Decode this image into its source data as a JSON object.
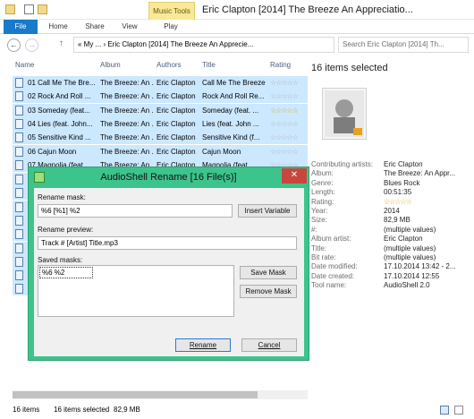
{
  "window": {
    "title": "Eric Clapton [2014] The Breeze An Appreciatio...",
    "context_tab": "Music Tools"
  },
  "ribbon": {
    "tabs": [
      "File",
      "Home",
      "Share",
      "View",
      "Play"
    ]
  },
  "nav": {
    "back_glyph": "←",
    "forward_glyph": "→",
    "up_glyph": "↑",
    "address": "«  My ...  ›  Eric Clapton [2014] The Breeze An Apprecie...",
    "search_placeholder": "Search Eric Clapton [2014] Th..."
  },
  "columns": [
    "Name",
    "Album",
    "Authors",
    "Title",
    "Rating"
  ],
  "files": [
    {
      "name": "01 Call Me The Bre...",
      "album": "The Breeze: An ...",
      "author": "Eric Clapton",
      "title": "Call Me The Breeze",
      "rating": 0
    },
    {
      "name": "02 Rock And Roll ...",
      "album": "The Breeze: An ...",
      "author": "Eric Clapton",
      "title": "Rock And Roll Re...",
      "rating": 0
    },
    {
      "name": "03 Someday (feat...",
      "album": "The Breeze: An ...",
      "author": "Eric Clapton",
      "title": "Someday (feat. ...",
      "rating": 5
    },
    {
      "name": "04 Lies (feat. John...",
      "album": "The Breeze: An ...",
      "author": "Eric Clapton",
      "title": "Lies (feat. John ...",
      "rating": 0
    },
    {
      "name": "05 Sensitive Kind ...",
      "album": "The Breeze: An ...",
      "author": "Eric Clapton",
      "title": "Sensitive Kind (f...",
      "rating": 0
    },
    {
      "name": "06 Cajun Moon",
      "album": "The Breeze: An ...",
      "author": "Eric Clapton",
      "title": "Cajun Moon",
      "rating": 0
    },
    {
      "name": "07 Magnolia (feat...",
      "album": "The Breeze: An ...",
      "author": "Eric Clapton",
      "title": "Magnolia (feat. ...",
      "rating": 0
    }
  ],
  "details": {
    "selection": "16 items selected",
    "props": [
      {
        "label": "Contributing artists:",
        "value": "Eric Clapton"
      },
      {
        "label": "Album:",
        "value": "The Breeze: An Appr..."
      },
      {
        "label": "Genre:",
        "value": "Blues Rock"
      },
      {
        "label": "Length:",
        "value": "00:51:35"
      },
      {
        "label": "Rating:",
        "value": "☆☆☆☆☆"
      },
      {
        "label": "Year:",
        "value": "2014"
      },
      {
        "label": "Size:",
        "value": "82,9 MB"
      },
      {
        "label": "#:",
        "value": "(multiple values)"
      },
      {
        "label": "Album artist:",
        "value": "Eric Clapton"
      },
      {
        "label": "Title:",
        "value": "(multiple values)"
      },
      {
        "label": "Bit rate:",
        "value": "(multiple values)"
      },
      {
        "label": "Date modified:",
        "value": "17.10.2014 13:42 - 2..."
      },
      {
        "label": "Date created:",
        "value": "17.10.2014 12:55"
      },
      {
        "label": "Tool name:",
        "value": "AudioShell 2.0"
      }
    ]
  },
  "status": {
    "count": "16 items",
    "selected": "16 items selected",
    "size": "82,9 MB"
  },
  "dialog": {
    "title": "AudioShell Rename [16 File(s)]",
    "close_glyph": "✕",
    "rename_mask_label": "Rename mask:",
    "rename_mask_value": "%6 [%1] %2",
    "insert_variable": "Insert Variable",
    "preview_label": "Rename preview:",
    "preview_value": "Track # [Artist] Title.mp3",
    "saved_masks_label": "Saved masks:",
    "saved_masks": [
      "%6 %2"
    ],
    "save_mask": "Save Mask",
    "remove_mask": "Remove Mask",
    "rename": "Rename",
    "cancel": "Cancel"
  }
}
